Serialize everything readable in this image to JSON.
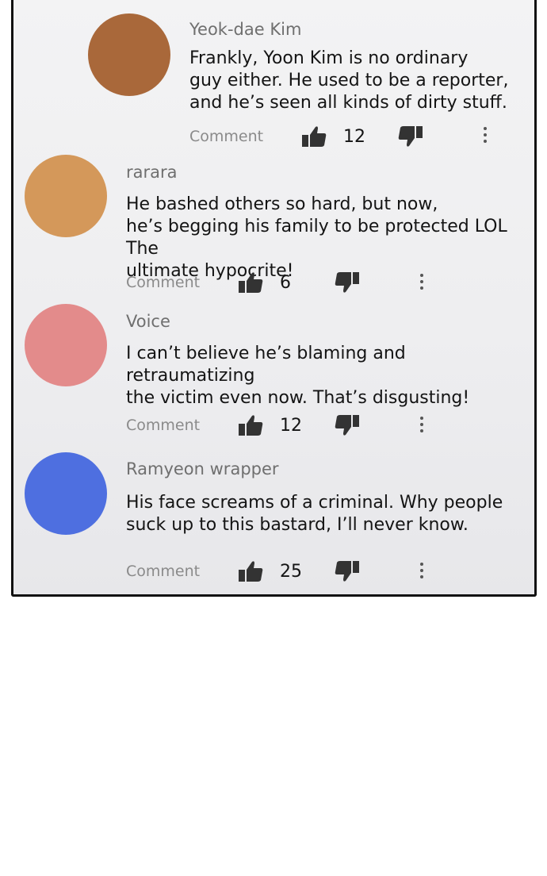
{
  "comments": [
    {
      "author": "Yeok-dae Kim",
      "text": "Frankly, Yoon Kim is no ordinary\nguy either. He used to be a reporter,\nand he’s seen all kinds of dirty stuff.",
      "comment_label": "Comment",
      "likes": "12",
      "avatar_color": "#a9683a"
    },
    {
      "author": "rarara",
      "text": "He bashed others so hard, but now,\nhe’s begging his family to be protected LOL The\nultimate hypocrite!",
      "comment_label": "Comment",
      "likes": "6",
      "avatar_color": "#d4985a"
    },
    {
      "author": "Voice",
      "text": "I can’t believe he’s blaming and retraumatizing\nthe victim even now. That’s disgusting!",
      "comment_label": "Comment",
      "likes": "12",
      "avatar_color": "#e38b8b"
    },
    {
      "author": "Ramyeon wrapper",
      "text": "His face screams of a criminal. Why people\nsuck up to this bastard, I’ll never know.",
      "comment_label": "Comment",
      "likes": "25",
      "avatar_color": "#4e6fe0"
    }
  ],
  "icons": {
    "like": "thumbs-up-icon",
    "dislike": "thumbs-down-icon",
    "more": "more-vertical-icon"
  }
}
